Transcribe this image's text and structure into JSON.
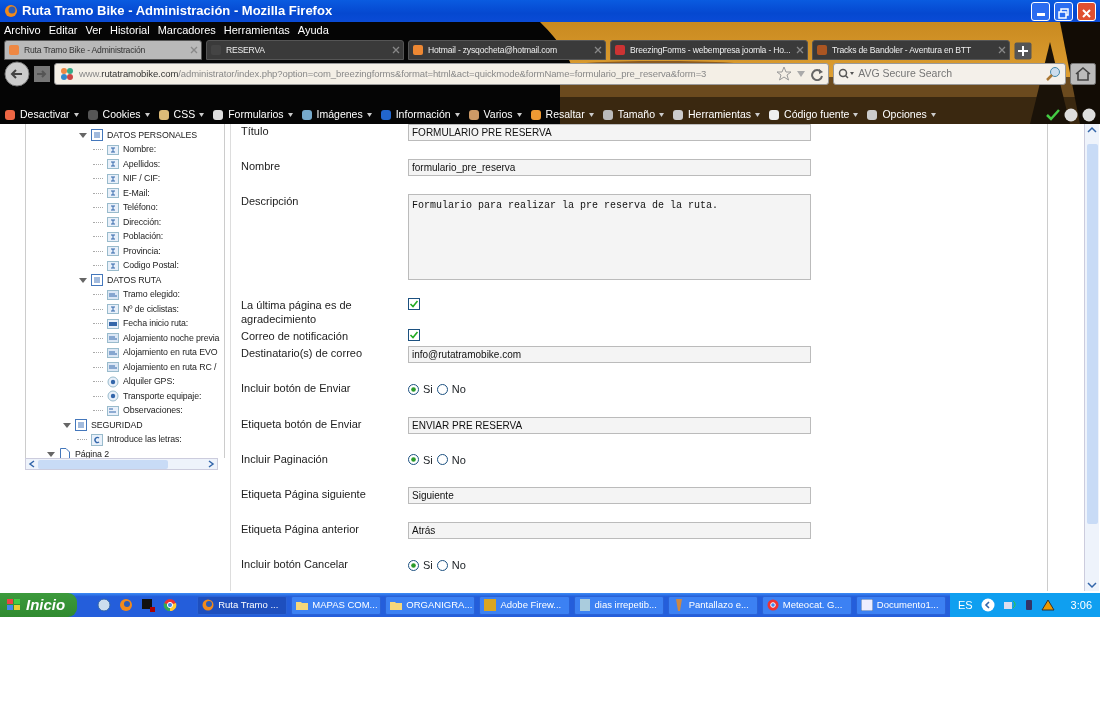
{
  "window": {
    "title": "Ruta Tramo Bike - Administración - Mozilla Firefox"
  },
  "menu": [
    "Archivo",
    "Editar",
    "Ver",
    "Historial",
    "Marcadores",
    "Herramientas",
    "Ayuda"
  ],
  "tabs": [
    {
      "label": "Ruta Tramo Bike - Administración",
      "selected": true
    },
    {
      "label": "RESERVA",
      "selected": false
    },
    {
      "label": "Hotmail - zysqocheta@hotmail.com",
      "selected": false
    },
    {
      "label": "BreezingForms - webempresa joomla - Ho...",
      "selected": false
    },
    {
      "label": "Tracks de Bandoler - Aventura en BTT",
      "selected": false
    }
  ],
  "address": {
    "prefix": "www.",
    "domain": "rutatramobike.com",
    "path": "/administrator/index.php?option=com_breezingforms&format=html&act=quickmode&formName=formulario_pre_reserva&form=3"
  },
  "search": {
    "placeholder": "AVG Secure Search"
  },
  "toolbar": [
    {
      "label": "Desactivar",
      "kind": "disable"
    },
    {
      "label": "Cookies",
      "kind": "cookies"
    },
    {
      "label": "CSS",
      "kind": "css"
    },
    {
      "label": "Formularios",
      "kind": "forms"
    },
    {
      "label": "Imágenes",
      "kind": "images"
    },
    {
      "label": "Información",
      "kind": "info"
    },
    {
      "label": "Varios",
      "kind": "misc"
    },
    {
      "label": "Resaltar",
      "kind": "highlight"
    },
    {
      "label": "Tamaño",
      "kind": "size"
    },
    {
      "label": "Herramientas",
      "kind": "tools"
    },
    {
      "label": "Código fuente",
      "kind": "source"
    },
    {
      "label": "Opciones",
      "kind": "options"
    }
  ],
  "tree": [
    {
      "children": [
        {
          "children": [
            {
              "label": "DATOS PERSONALES",
              "kind": "section",
              "expanded": true,
              "children": [
                {
                  "label": "Nombre:",
                  "kind": "text"
                },
                {
                  "label": "Apellidos:",
                  "kind": "text"
                },
                {
                  "label": "NIF / CIF:",
                  "kind": "text"
                },
                {
                  "label": "E-Mail:",
                  "kind": "text"
                },
                {
                  "label": "Teléfono:",
                  "kind": "text"
                },
                {
                  "label": "Dirección:",
                  "kind": "text"
                },
                {
                  "label": "Población:",
                  "kind": "text"
                },
                {
                  "label": "Provincia:",
                  "kind": "text"
                },
                {
                  "label": "Codigo Postal:",
                  "kind": "text"
                }
              ]
            },
            {
              "label": "DATOS RUTA",
              "kind": "section",
              "expanded": true,
              "children": [
                {
                  "label": "Tramo elegido:",
                  "kind": "select"
                },
                {
                  "label": "Nº de ciclistas:",
                  "kind": "text"
                },
                {
                  "label": "Fecha inicio ruta:",
                  "kind": "date"
                },
                {
                  "label": "Alojamiento noche previa",
                  "kind": "select"
                },
                {
                  "label": "Alojamiento en ruta EVO",
                  "kind": "select"
                },
                {
                  "label": "Alojamiento en ruta RC /",
                  "kind": "select"
                },
                {
                  "label": "Alquiler GPS:",
                  "kind": "radio"
                },
                {
                  "label": "Transporte equipaje:",
                  "kind": "radio"
                },
                {
                  "label": "Observaciones:",
                  "kind": "textarea"
                }
              ]
            }
          ]
        },
        {
          "label": "SEGURIDAD",
          "kind": "section",
          "expanded": true,
          "children": [
            {
              "label": "Introduce las letras:",
              "kind": "captcha"
            }
          ]
        }
      ]
    },
    {
      "label": "Página 2",
      "kind": "page",
      "expanded": true
    }
  ],
  "form": [
    {
      "kind": "text",
      "label": "Título",
      "value": "FORMULARIO PRE RESERVA"
    },
    {
      "kind": "text",
      "label": "Nombre",
      "value": "formulario_pre_reserva"
    },
    {
      "kind": "textarea",
      "label": "Descripción",
      "value": "Formulario para realizar la pre reserva de la ruta."
    },
    {
      "kind": "checkbox",
      "label": "La última página es de agradecimiento",
      "checked": true
    },
    {
      "kind": "checkbox",
      "label": "Correo de notificación",
      "checked": true
    },
    {
      "kind": "text",
      "label": "Destinatario(s) de correo",
      "value": "info@rutatramobike.com"
    },
    {
      "kind": "radio",
      "label": "Incluir botón de Enviar",
      "options": [
        {
          "label": "Si",
          "selected": true
        },
        {
          "label": "No",
          "selected": false
        }
      ]
    },
    {
      "kind": "text",
      "label": "Etiqueta botón de Enviar",
      "value": "ENVIAR PRE RESERVA"
    },
    {
      "kind": "radio",
      "label": "Incluir Paginación",
      "options": [
        {
          "label": "Si",
          "selected": true
        },
        {
          "label": "No",
          "selected": false
        }
      ]
    },
    {
      "kind": "text",
      "label": "Etiqueta Página siguiente",
      "value": "Siguiente"
    },
    {
      "kind": "text",
      "label": "Etiqueta Página anterior",
      "value": "Atrás"
    },
    {
      "kind": "radio",
      "label": "Incluir botón Cancelar",
      "options": [
        {
          "label": "Si",
          "selected": true
        },
        {
          "label": "No",
          "selected": false
        }
      ]
    }
  ],
  "taskbar": {
    "start": "Inicio",
    "items": [
      {
        "label": "Ruta Tramo ...",
        "kind": "firefox",
        "selected": true
      },
      {
        "label": "MAPAS COM...",
        "kind": "folder",
        "selected": false
      },
      {
        "label": "ORGANIGRA...",
        "kind": "folder",
        "selected": false
      },
      {
        "label": "Adobe Firew...",
        "kind": "fireworks",
        "selected": false
      },
      {
        "label": "dias irrepetib...",
        "kind": "doc",
        "selected": false
      },
      {
        "label": "Pantallazo e...",
        "kind": "paint",
        "selected": false
      },
      {
        "label": "Meteocat. G...",
        "kind": "chrome",
        "selected": false
      },
      {
        "label": "Documento1...",
        "kind": "word",
        "selected": false
      }
    ],
    "language": "ES",
    "clock": "3:06"
  }
}
